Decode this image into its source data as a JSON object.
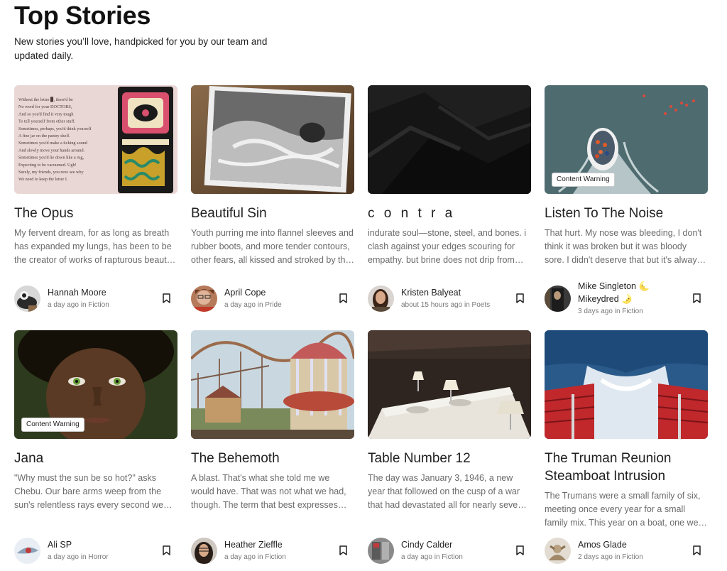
{
  "header": {
    "title": "Top Stories",
    "subtitle": "New stories you’ll love, handpicked for you by our team and updated daily."
  },
  "content_warning_label": "Content Warning",
  "stories": [
    {
      "title": "The Opus",
      "excerpt": "My fervent dream, for as long as breath has expanded my lungs, has been to be the creator of works of rapturous beauty that will echo through time.",
      "author": "Hannah Moore",
      "time": "a day ago",
      "in_word": "in",
      "category": "Fiction",
      "image_text": [
        "Without the letter ▉, there'd be",
        "No word for your DOCTORS,",
        "And so you'd find it very tough",
        "To tell yourself from other stuff.",
        "Sometimes, perhaps, you'd think yourself",
        "A fine jar on the pantry shelf.",
        "Sometimes you'd make a ticking sound",
        "And slowly move your hands around.",
        "Sometimes you'd lie down like a rug,",
        "Expecting to be vacuumed. Ugh!",
        "Surely, my friends, you now see why",
        "We need to keep the letter I."
      ]
    },
    {
      "title": "Beautiful Sin",
      "excerpt": "Youth purring me into flannel sleeves and rubber boots, and more tender contours, other fears, all kissed and stroked by the hands of a lover.",
      "author": "April Cope",
      "time": "a day ago",
      "in_word": "in",
      "category": "Pride"
    },
    {
      "title": "c o n t r a",
      "excerpt": "indurate soul—stone, steel, and bones. i clash against your edges scouring for empathy. but brine does not drip from stone.",
      "author": "Kristen Balyeat",
      "time": "about 15 hours ago",
      "in_word": "in",
      "category": "Poets"
    },
    {
      "title": "Listen To The Noise",
      "excerpt": "That hurt. My nose was bleeding, I don't think it was broken but it was bloody sore. I didn't deserve that but it's always the same.",
      "author": "Mike Singleton 🌜 Mikeydred 🌛",
      "time": "3 days ago",
      "in_word": "in",
      "category": "Fiction",
      "content_warning": true
    },
    {
      "title": "Jana",
      "excerpt": "\"Why must the sun be so hot?\" asks Chebu. Our bare arms weep from the sun's relentless rays every second we spend outside.",
      "author": "Ali SP",
      "time": "a day ago",
      "in_word": "in",
      "category": "Horror",
      "content_warning": true
    },
    {
      "title": "The Behemoth",
      "excerpt": "A blast. That's what she told me we would have. That was not what we had, though. The term that best expresses what we had is a nightmare.",
      "author": "Heather Zieffle",
      "time": "a day ago",
      "in_word": "in",
      "category": "Fiction"
    },
    {
      "title": "Table Number 12",
      "excerpt": "The day was January 3, 1946, a new year that followed on the cusp of a war that had devastated all for nearly seven years.",
      "author": "Cindy Calder",
      "time": "a day ago",
      "in_word": "in",
      "category": "Fiction"
    },
    {
      "title": "The Truman Reunion Steamboat Intrusion",
      "excerpt": "The Trumans were a small family of six, meeting once every year for a small family mix. This year on a boat, one we would never forget.",
      "author": "Amos Glade",
      "time": "2 days ago",
      "in_word": "in",
      "category": "Fiction"
    }
  ],
  "icons": {
    "bookmark": "bookmark-icon"
  },
  "colors": {
    "text": "#1f1f1f",
    "excerpt": "#6a6a6a",
    "meta": "#777777"
  }
}
